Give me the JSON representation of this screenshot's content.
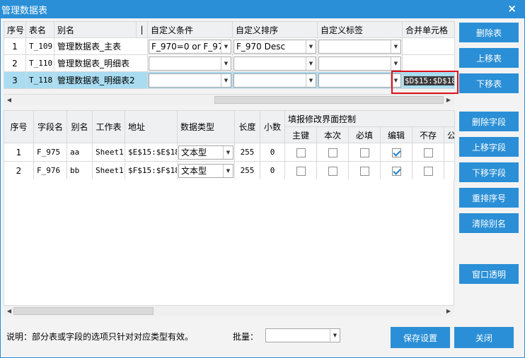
{
  "window": {
    "title": "管理数据表",
    "close": "×"
  },
  "table_list": {
    "headers": [
      "序号",
      "表名",
      "别名",
      "|",
      "自定义条件",
      "自定义排序",
      "自定义标签",
      "合并单元格"
    ],
    "rows": [
      {
        "num": "1",
        "name": "T_109",
        "alias": "管理数据表_主表",
        "cond": "F_970=0 or F_97",
        "sort": "F_970 Desc",
        "label": "",
        "merge": ""
      },
      {
        "num": "2",
        "name": "T_110",
        "alias": "管理数据表_明细表",
        "cond": "",
        "sort": "",
        "label": "",
        "merge": ""
      },
      {
        "num": "3",
        "name": "T_118",
        "alias": "管理数据表_明细表2",
        "cond": "",
        "sort": "",
        "label": "",
        "merge": "$D$15:$D$18"
      }
    ]
  },
  "field_list": {
    "headers": {
      "num": "序号",
      "field": "字段名",
      "alias": "别名",
      "sheet": "工作表",
      "addr": "地址",
      "type": "数据类型",
      "len": "长度",
      "dec": "小数",
      "group": "填报修改界面控制",
      "sub": [
        "主键",
        "本次",
        "必填",
        "编辑",
        "不存",
        "公"
      ]
    },
    "rows": [
      {
        "num": "1",
        "field": "F_975",
        "alias": "aa",
        "sheet": "Sheet1",
        "addr": "$E$15:$E$18",
        "type": "文本型",
        "len": "255",
        "dec": "0",
        "checks": [
          false,
          false,
          false,
          true,
          false
        ]
      },
      {
        "num": "2",
        "field": "F_976",
        "alias": "bb",
        "sheet": "Sheet1",
        "addr": "$F$15:$F$18",
        "type": "文本型",
        "len": "255",
        "dec": "0",
        "checks": [
          false,
          false,
          false,
          true,
          false
        ]
      }
    ]
  },
  "buttons_top": {
    "delete_table": "删除表",
    "move_up_table": "上移表",
    "move_down_table": "下移表"
  },
  "buttons_mid": {
    "delete_field": "删除字段",
    "move_up_field": "上移字段",
    "move_down_field": "下移字段",
    "renumber": "重排序号",
    "clear_alias": "清除别名",
    "window_transparent": "窗口透明"
  },
  "footer": {
    "note": "说明：部分表或字段的选项只针对对应类型有效。",
    "batch_label": "批量：",
    "batch_value": "",
    "save": "保存设置",
    "close": "关闭"
  },
  "colors": {
    "accent": "#2a8fd6",
    "selected_row": "#a9dcf0",
    "highlight": "#e0101a"
  }
}
